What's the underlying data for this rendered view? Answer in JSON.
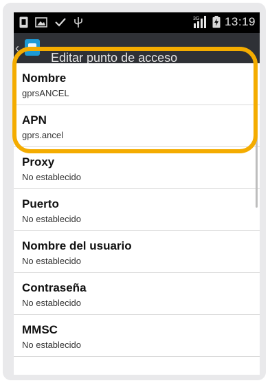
{
  "status_bar": {
    "network_badge": "3G",
    "time": "13:19",
    "icons": [
      "sim-icon",
      "image-icon",
      "check-icon",
      "usb-icon",
      "signal-icon",
      "battery-icon"
    ]
  },
  "action_bar": {
    "title": "Editar punto de acceso"
  },
  "settings": [
    {
      "title": "Nombre",
      "value": "gprsANCEL"
    },
    {
      "title": "APN",
      "value": "gprs.ancel"
    },
    {
      "title": "Proxy",
      "value": "No establecido"
    },
    {
      "title": "Puerto",
      "value": "No establecido"
    },
    {
      "title": "Nombre del usuario",
      "value": "No establecido"
    },
    {
      "title": "Contraseña",
      "value": "No establecido"
    },
    {
      "title": "MMSC",
      "value": "No establecido"
    }
  ],
  "colors": {
    "highlight": "#f4ac00",
    "status_bar": "#000000",
    "action_bar": "#2f3136"
  }
}
